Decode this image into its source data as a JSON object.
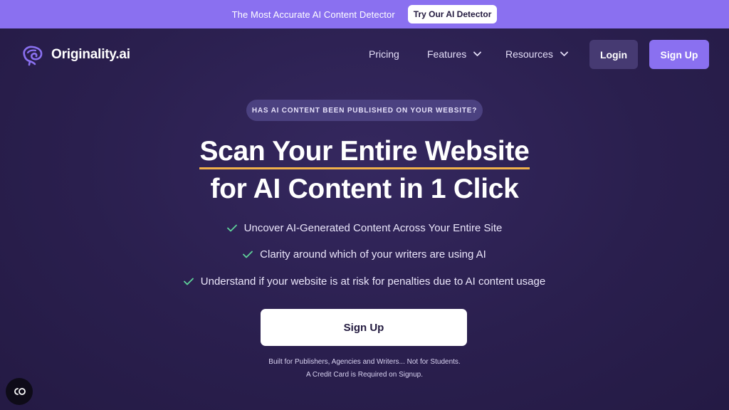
{
  "announcement": {
    "text": "The Most Accurate AI Content Detector",
    "cta_label": "Try Our AI Detector"
  },
  "nav": {
    "logo_text": "Originality.ai",
    "links": [
      {
        "label": "Pricing",
        "has_dropdown": false
      },
      {
        "label": "Features",
        "has_dropdown": true
      },
      {
        "label": "Resources",
        "has_dropdown": true
      }
    ],
    "login_label": "Login",
    "signup_label": "Sign Up"
  },
  "hero": {
    "eyebrow": "HAS AI CONTENT BEEN PUBLISHED ON YOUR WEBSITE?",
    "headline_line1": "Scan Your Entire Website",
    "headline_line2": "for AI Content in 1 Click",
    "bullets": [
      "Uncover AI-Generated Content Across Your Entire Site",
      "Clarity around which of your writers are using AI",
      "Understand if your website is at risk for penalties due to AI content usage"
    ],
    "cta_label": "Sign Up",
    "footnote_line1": "Built for Publishers, Agencies and Writers... Not for Students.",
    "footnote_line2": "A Credit Card is Required on Signup."
  },
  "chat_widget": {
    "icon": "chat-widget-icon"
  },
  "colors": {
    "background": "#2a1f4e",
    "accent": "#8a70f0",
    "underline": "#f0b04a",
    "check": "#5fd39a"
  }
}
